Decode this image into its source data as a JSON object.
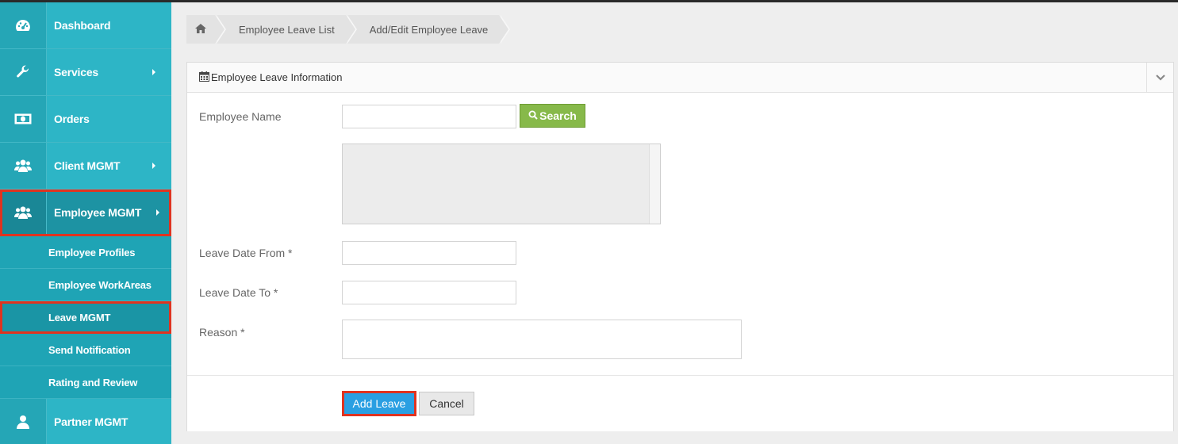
{
  "sidebar": {
    "items": [
      {
        "label": "Dashboard",
        "icon": "dashboard-icon"
      },
      {
        "label": "Services",
        "icon": "wrench-icon"
      },
      {
        "label": "Orders",
        "icon": "money-icon"
      },
      {
        "label": "Client MGMT",
        "icon": "users-icon"
      },
      {
        "label": "Employee MGMT",
        "icon": "users-icon"
      },
      {
        "label": "Partner MGMT",
        "icon": "user-icon"
      }
    ],
    "subitems": [
      {
        "label": "Employee Profiles"
      },
      {
        "label": "Employee WorkAreas"
      },
      {
        "label": "Leave MGMT"
      },
      {
        "label": "Send Notification"
      },
      {
        "label": "Rating and Review"
      }
    ]
  },
  "breadcrumb": {
    "home_icon": "home-icon",
    "items": [
      "Employee Leave List",
      "Add/Edit Employee Leave"
    ]
  },
  "panel": {
    "title": "Employee Leave Information",
    "title_icon": "calendar-icon"
  },
  "form": {
    "employee_name_label": "Employee Name",
    "employee_name_value": "",
    "search_label": "Search",
    "leave_from_label": "Leave Date From *",
    "leave_from_value": "",
    "leave_to_label": "Leave Date To *",
    "leave_to_value": "",
    "reason_label": "Reason *",
    "reason_value": ""
  },
  "actions": {
    "add_label": "Add Leave",
    "cancel_label": "Cancel"
  },
  "colors": {
    "sidebar": "#2db5c6",
    "highlight": "#e0331f",
    "search_button": "#87b94a",
    "primary_button": "#2a9fe2"
  }
}
